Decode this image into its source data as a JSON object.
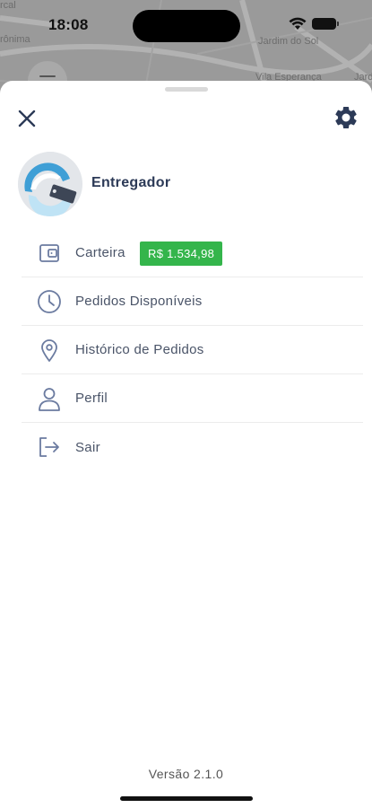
{
  "status_bar": {
    "time": "18:08"
  },
  "map": {
    "labels": [
      "Jardim do Sol",
      "Vila Esperança",
      "rcal",
      "rônima",
      "Jardi"
    ]
  },
  "header": {
    "close_icon": "close-icon",
    "settings_icon": "gear-icon"
  },
  "user": {
    "name": "Entregador"
  },
  "menu": {
    "items": [
      {
        "label": "Carteira",
        "icon": "wallet-icon",
        "badge": "R$ 1.534,98"
      },
      {
        "label": "Pedidos Disponíveis",
        "icon": "clock-icon"
      },
      {
        "label": "Histórico de Pedidos",
        "icon": "location-pin-icon"
      },
      {
        "label": "Perfil",
        "icon": "user-icon"
      },
      {
        "label": "Sair",
        "icon": "logout-icon"
      }
    ]
  },
  "footer": {
    "version": "Versão 2.1.0"
  },
  "colors": {
    "accent": "#2c3a57",
    "badge_bg": "#34b54b",
    "icon": "#6b7ba0"
  }
}
